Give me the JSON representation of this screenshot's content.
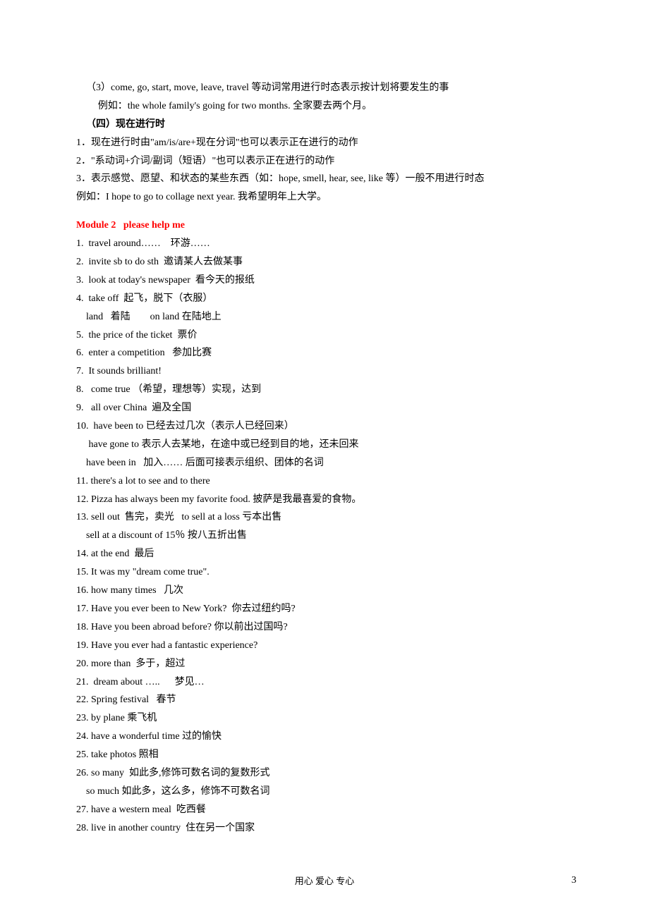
{
  "section1": {
    "l1": "（3）come, go, start, move, leave, travel 等动词常用进行时态表示按计划将要发生的事",
    "l2": "例如：the whole family's going for two months. 全家要去两个月。",
    "heading": "（四）现在进行时",
    "l3": "1．现在进行时由\"am/is/are+现在分词\"也可以表示正在进行的动作",
    "l4": "2．\"系动词+介词/副词（短语）\"也可以表示正在进行的动作",
    "l5": "3．表示感觉、愿望、和状态的某些东西（如：hope, smell, hear, see, like 等）一般不用进行时态",
    "l6": "例如：I hope to go to collage next year. 我希望明年上大学。"
  },
  "module2": {
    "title": "Module 2   please help me",
    "items": [
      "1.  travel around……    环游……",
      "2.  invite sb to do sth  邀请某人去做某事",
      "3.  look at today's newspaper  看今天的报纸",
      "4.  take off  起飞，脱下（衣服）",
      "    land   着陆        on land 在陆地上",
      "5.  the price of the ticket  票价",
      "6.  enter a competition   参加比赛",
      "7.  It sounds brilliant!",
      "8.   come true （希望，理想等）实现，达到",
      "9.   all over China  遍及全国",
      "10.  have been to 已经去过几次（表示人已经回来）",
      "     have gone to 表示人去某地，在途中或已经到目的地，还未回来",
      "    have been in   加入…… 后面可接表示组织、团体的名词",
      "11. there's a lot to see and to there",
      "12. Pizza has always been my favorite food. 披萨是我最喜爱的食物。",
      "13. sell out  售完，卖光   to sell at a loss 亏本出售",
      "    sell at a discount of 15％ 按八五折出售",
      "14. at the end  最后",
      "15. It was my \"dream come true\".",
      "16. how many times   几次",
      "17. Have you ever been to New York?  你去过纽约吗?",
      "18. Have you been abroad before? 你以前出过国吗?",
      "19. Have you ever had a fantastic experience?",
      "20. more than  多于，超过",
      "21.  dream about …..      梦见…",
      "22. Spring festival   春节",
      "23. by plane 乘飞机",
      "24. have a wonderful time 过的愉快",
      "25. take photos 照相",
      "26. so many  如此多,修饰可数名词的复数形式",
      "    so much 如此多，这么多，修饰不可数名词",
      "27. have a western meal  吃西餐",
      "28. live in another country  住在另一个国家"
    ]
  },
  "footer": "用心   爱心   专心",
  "pageNumber": "3"
}
